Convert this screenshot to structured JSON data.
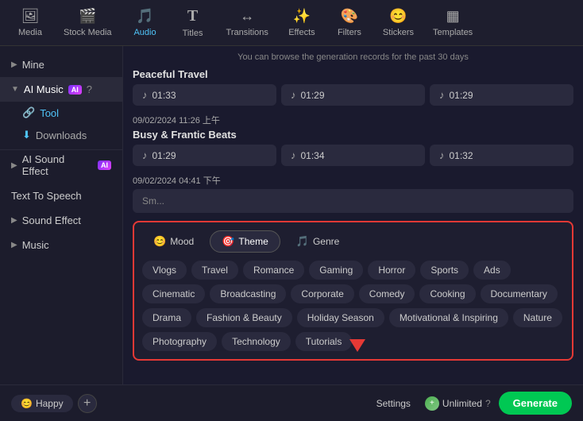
{
  "nav": {
    "items": [
      {
        "id": "media",
        "label": "Media",
        "icon": "🖼",
        "active": false
      },
      {
        "id": "stock-media",
        "label": "Stock Media",
        "icon": "🎬",
        "active": false
      },
      {
        "id": "audio",
        "label": "Audio",
        "icon": "🎵",
        "active": true
      },
      {
        "id": "titles",
        "label": "Titles",
        "icon": "T",
        "active": false
      },
      {
        "id": "transitions",
        "label": "Transitions",
        "icon": "↔",
        "active": false
      },
      {
        "id": "effects",
        "label": "Effects",
        "icon": "✨",
        "active": false
      },
      {
        "id": "filters",
        "label": "Filters",
        "icon": "🎨",
        "active": false
      },
      {
        "id": "stickers",
        "label": "Stickers",
        "icon": "😊",
        "active": false
      },
      {
        "id": "templates",
        "label": "Templates",
        "icon": "▦",
        "active": false
      }
    ]
  },
  "sidebar": {
    "items": [
      {
        "id": "mine",
        "label": "Mine",
        "arrow": "▶",
        "indent": false
      },
      {
        "id": "ai-music",
        "label": "AI Music",
        "badge": "AI",
        "arrow": "▼",
        "indent": false,
        "active": true
      },
      {
        "id": "tool",
        "label": "Tool",
        "icon": "🔗",
        "indent": true
      },
      {
        "id": "downloads",
        "label": "Downloads",
        "icon": "⬇",
        "indent": true
      },
      {
        "id": "ai-sound-effect",
        "label": "AI Sound Effect",
        "badge": "AI",
        "arrow": "▶",
        "indent": false
      },
      {
        "id": "text-to-speech",
        "label": "Text To Speech",
        "indent": false
      },
      {
        "id": "sound-effect",
        "label": "Sound Effect",
        "arrow": "▶",
        "indent": false
      },
      {
        "id": "music",
        "label": "Music",
        "arrow": "▶",
        "indent": false
      }
    ]
  },
  "content": {
    "info_text": "You can browse the generation records for the past 30 days",
    "track_groups": [
      {
        "title": "Peaceful Travel",
        "tracks": [
          {
            "duration": "01:33"
          },
          {
            "duration": "01:29"
          },
          {
            "duration": "01:29"
          }
        ]
      },
      {
        "date": "09/02/2024 11:26 上午",
        "title": "Busy & Frantic Beats",
        "tracks": [
          {
            "duration": "01:29"
          },
          {
            "duration": "01:34"
          },
          {
            "duration": "01:32"
          }
        ]
      },
      {
        "date": "09/02/2024 04:41 下午",
        "title_stub": "Sm..."
      }
    ]
  },
  "genre_selector": {
    "tabs": [
      {
        "id": "mood",
        "label": "Mood",
        "icon": "😊"
      },
      {
        "id": "theme",
        "label": "Theme",
        "icon": "🎯",
        "active": true
      },
      {
        "id": "genre",
        "label": "Genre",
        "icon": "🎵"
      }
    ],
    "tags": [
      "Vlogs",
      "Travel",
      "Romance",
      "Gaming",
      "Horror",
      "Sports",
      "Ads",
      "Cinematic",
      "Broadcasting",
      "Corporate",
      "Comedy",
      "Cooking",
      "Documentary",
      "Drama",
      "Fashion & Beauty",
      "Holiday Season",
      "Motivational & Inspiring",
      "Nature",
      "Photography",
      "Technology",
      "Tutorials"
    ]
  },
  "bottom_bar": {
    "selected_tag": "Happy",
    "selected_tag_icon": "😊",
    "add_button_label": "+",
    "settings_label": "Settings",
    "unlimited_label": "Unlimited",
    "generate_label": "Generate"
  }
}
